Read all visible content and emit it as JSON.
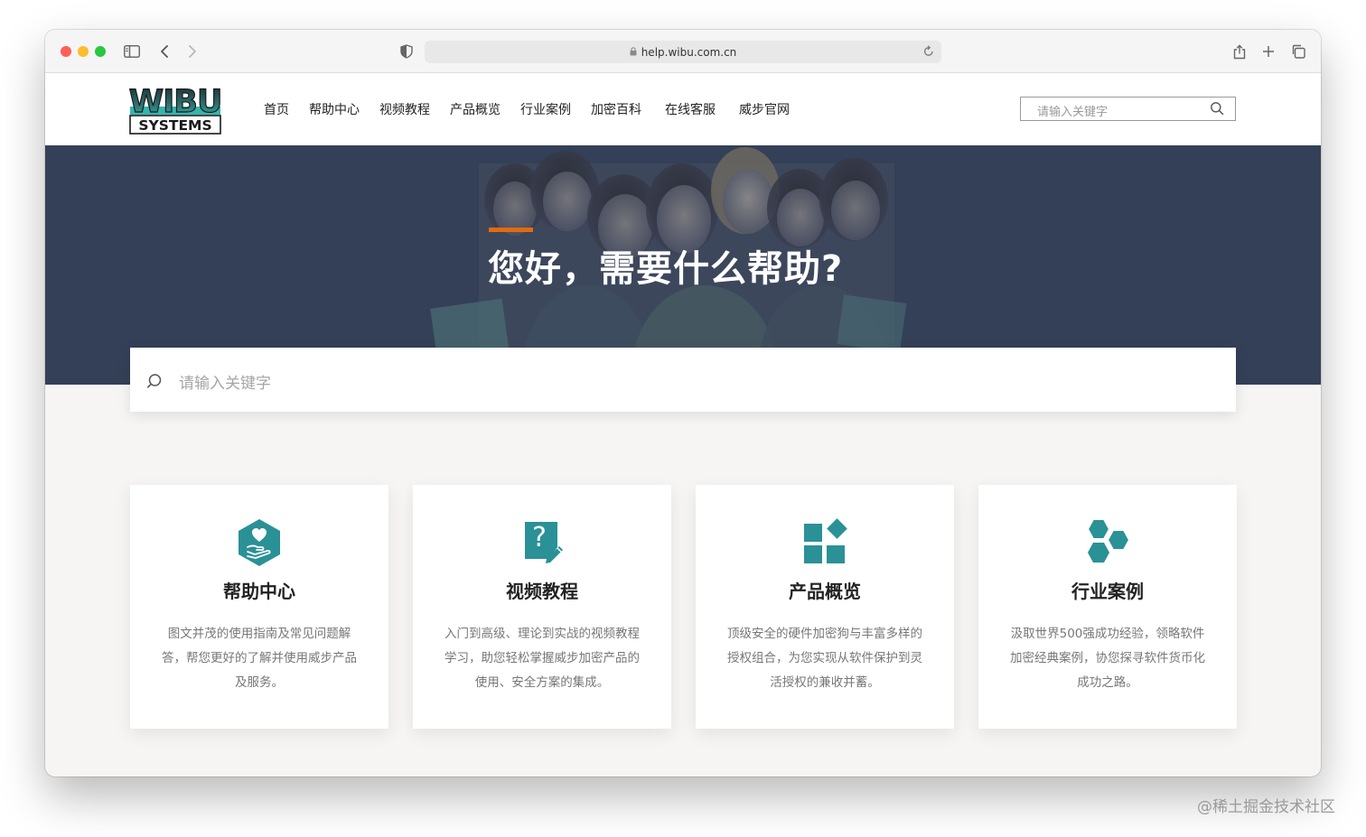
{
  "browser": {
    "url": "help.wibu.com.cn"
  },
  "header": {
    "logo_text_top": "WIBU",
    "logo_text_bottom": "SYSTEMS",
    "nav": [
      {
        "label": "首页"
      },
      {
        "label": "帮助中心"
      },
      {
        "label": "视频教程"
      },
      {
        "label": "产品概览"
      },
      {
        "label": "行业案例"
      },
      {
        "label": "加密百科"
      },
      {
        "label": "在线客服"
      },
      {
        "label": "威步官网"
      }
    ],
    "search_placeholder": "请输入关键字"
  },
  "hero": {
    "title": "您好，需要什么帮助?",
    "search_placeholder": "请输入关键字"
  },
  "cards": [
    {
      "title": "帮助中心",
      "desc": "图文并茂的使用指南及常见问题解答，帮您更好的了解并使用威步产品及服务。",
      "icon": "help-hand-icon"
    },
    {
      "title": "视频教程",
      "desc": "入门到高级、理论到实战的视频教程学习，助您轻松掌握威步加密产品的使用、安全方案的集成。",
      "icon": "question-document-icon"
    },
    {
      "title": "产品概览",
      "desc": "顶级安全的硬件加密狗与丰富多样的授权组合，为您实现从软件保护到灵活授权的兼收并蓄。",
      "icon": "product-blocks-icon"
    },
    {
      "title": "行业案例",
      "desc": "汲取世界500强成功经验，领略软件加密经典案例，协您探寻软件货币化成功之路。",
      "icon": "hexagon-cluster-icon"
    }
  ],
  "colors": {
    "teal": "#2a9196",
    "hero_bg": "#344057",
    "accent": "#e26a10"
  },
  "watermark": "@稀土掘金技术社区"
}
